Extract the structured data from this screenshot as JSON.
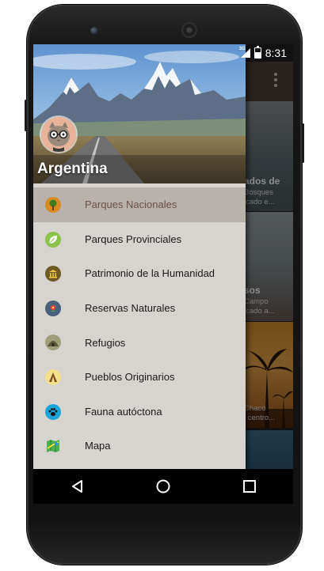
{
  "status_bar": {
    "network": "3G",
    "time": "8:31"
  },
  "drawer": {
    "header": {
      "title": "Argentina"
    },
    "items": [
      {
        "label": "Parques Nacionales",
        "icon": "tree-icon",
        "color": "#d98b22",
        "selected": true
      },
      {
        "label": "Parques Provinciales",
        "icon": "leaf-icon",
        "color": "#8bc34a",
        "selected": false
      },
      {
        "label": "Patrimonio de la Humanidad",
        "icon": "landmark-icon",
        "color": "#6e5a22",
        "selected": false
      },
      {
        "label": "Reservas Naturales",
        "icon": "flower-icon",
        "color": "#49607a",
        "selected": false
      },
      {
        "label": "Refugios",
        "icon": "shelter-icon",
        "color": "#9e9e7a",
        "selected": false
      },
      {
        "label": "Pueblos Originarios",
        "icon": "tent-icon",
        "color": "#f2e08a",
        "selected": false
      },
      {
        "label": "Fauna autóctona",
        "icon": "paw-icon",
        "color": "#1ca3d8",
        "selected": false
      },
      {
        "label": "Mapa",
        "icon": "map-icon",
        "color": "#4caf50",
        "selected": false
      }
    ]
  },
  "background_list": {
    "cards": [
      {
        "title": "ados de",
        "lines": [
          "Bosques",
          "icado e..."
        ]
      },
      {
        "title": "sos",
        "lines": [
          "Campo",
          "icado a..."
        ]
      },
      {
        "title": "",
        "lines": [
          "Chaco",
          "l centro..."
        ]
      }
    ]
  },
  "nav_bar": {
    "back": "back-icon",
    "home": "home-icon",
    "recents": "recents-icon"
  },
  "colors": {
    "drawer_bg": "#d7d3cf",
    "selected_bg": "#b8b1ac",
    "app_bar": "#4e3f37"
  }
}
